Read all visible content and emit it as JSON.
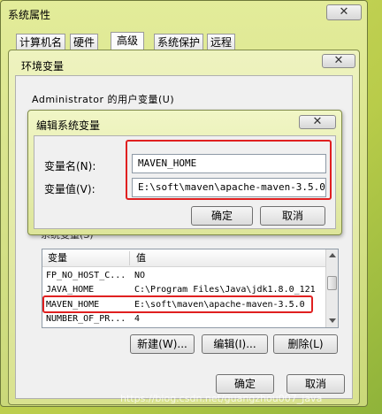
{
  "outer": {
    "title": "系统属性"
  },
  "tabs": [
    {
      "label": "计算机名"
    },
    {
      "label": "硬件"
    },
    {
      "label": "高级"
    },
    {
      "label": "系统保护"
    },
    {
      "label": "远程"
    }
  ],
  "env": {
    "title": "环境变量",
    "close_glyph": "✕",
    "user_group": "Administrator 的用户变量(U)",
    "system_group_partial": "系统变量(S)",
    "columns": {
      "name": "变量",
      "value": "值"
    },
    "system_vars": [
      {
        "name": "FP_NO_HOST_C...",
        "value": "NO"
      },
      {
        "name": "JAVA_HOME",
        "value": "C:\\Program Files\\Java\\jdk1.8.0_121"
      },
      {
        "name": "MAVEN_HOME",
        "value": "E:\\soft\\maven\\apache-maven-3.5.0"
      },
      {
        "name": "NUMBER_OF_PR...",
        "value": "4"
      }
    ],
    "new_label": "新建(W)...",
    "edit_label": "编辑(I)...",
    "delete_label": "删除(L)",
    "ok_label": "确定",
    "cancel_label": "取消"
  },
  "edit": {
    "title": "编辑系统变量",
    "close_glyph": "✕",
    "name_label": "变量名(N):",
    "value_label": "变量值(V):",
    "name_value": "MAVEN_HOME",
    "value_value": "E:\\soft\\maven\\apache-maven-3.5.0",
    "ok_label": "确定",
    "cancel_label": "取消"
  },
  "watermark": "https://blog.csdn.net/guangzhou007_java",
  "colors": {
    "highlight": "#e02020",
    "selection": "#3399ff"
  }
}
